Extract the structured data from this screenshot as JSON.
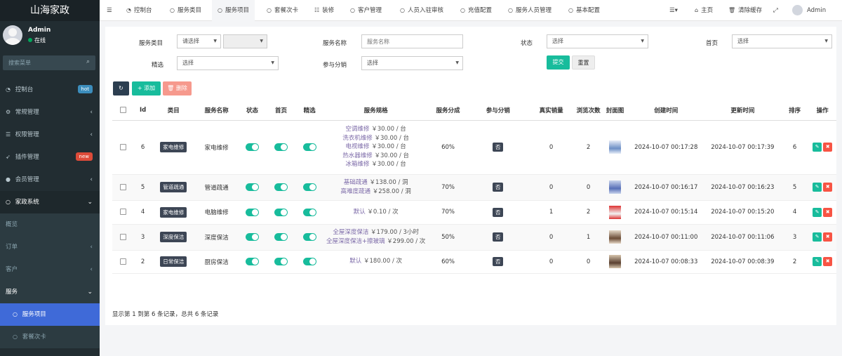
{
  "brand": "山海家政",
  "user": {
    "name": "Admin",
    "status": "在线"
  },
  "search": {
    "placeholder": "搜索菜单"
  },
  "nav": [
    {
      "icon": "dashboard-icon",
      "label": "控制台",
      "badge": "hot",
      "badge_color": "#3c8dbc"
    },
    {
      "icon": "gear-icon",
      "label": "常规管理",
      "chev": "‹"
    },
    {
      "icon": "users-icon",
      "label": "权限管理",
      "chev": "‹"
    },
    {
      "icon": "rocket-icon",
      "label": "插件管理",
      "badge": "new",
      "badge_color": "#dd4b39"
    },
    {
      "icon": "user-icon",
      "label": "会员管理",
      "chev": "‹"
    },
    {
      "icon": "circle-icon",
      "label": "家政系统",
      "chev": "⌄"
    },
    {
      "label": "概览"
    },
    {
      "label": "订单",
      "chev": "‹"
    },
    {
      "label": "客户",
      "chev": "‹"
    },
    {
      "label": "服务",
      "chev": "⌄"
    },
    {
      "icon": "circle-icon",
      "label": "服务项目"
    },
    {
      "icon": "circle-icon",
      "label": "套餐次卡"
    }
  ],
  "topbar": {
    "tabs": [
      {
        "icon": "dashboard-icon",
        "label": "控制台"
      },
      {
        "icon": "circle-icon",
        "label": "服务类目"
      },
      {
        "icon": "circle-icon",
        "label": "服务项目"
      },
      {
        "icon": "circle-icon",
        "label": "套餐次卡"
      },
      {
        "icon": "list-icon",
        "label": "装修"
      },
      {
        "icon": "circle-icon",
        "label": "客户管理"
      },
      {
        "icon": "circle-icon",
        "label": "人员入驻审核"
      },
      {
        "icon": "circle-icon",
        "label": "充值配置"
      },
      {
        "icon": "circle-icon",
        "label": "服务人员管理"
      },
      {
        "icon": "circle-icon",
        "label": "基本配置"
      }
    ],
    "home": "主页",
    "clear_cache": "清除缓存",
    "admin": "Admin"
  },
  "filters": {
    "category_label": "服务类目",
    "category_value": "请选择",
    "name_label": "服务名称",
    "name_placeholder": "服务名称",
    "status_label": "状态",
    "status_value": "选择",
    "home_label": "首页",
    "home_value": "选择",
    "featured_label": "精选",
    "featured_value": "选择",
    "dist_label": "参与分销",
    "dist_value": "选择",
    "submit": "提交",
    "reset": "重置"
  },
  "toolbar": {
    "add": "添加",
    "delete": "删除"
  },
  "table": {
    "headers": [
      "Id",
      "类目",
      "服务名称",
      "状态",
      "首页",
      "精选",
      "服务规格",
      "服务分成",
      "参与分销",
      "真实销量",
      "浏览次数",
      "封面图",
      "创建时间",
      "更新时间",
      "排序",
      "操作"
    ],
    "rows": [
      {
        "id": "6",
        "category": "家电维修",
        "name": "家电维修",
        "specs": [
          [
            "空调维修",
            "￥30.00 / 台"
          ],
          [
            "洗衣机维修",
            "￥30.00 / 台"
          ],
          [
            "电视维修",
            "￥30.00 / 台"
          ],
          [
            "热水器维修",
            "￥30.00 / 台"
          ],
          [
            "冰箱维修",
            "￥30.00 / 台"
          ]
        ],
        "share": "60%",
        "dist": "否",
        "sales": "0",
        "views": "2",
        "created": "2024-10-07 00:17:28",
        "updated": "2024-10-07 00:17:39",
        "sort": "6"
      },
      {
        "id": "5",
        "category": "管道疏通",
        "name": "管道疏通",
        "specs": [
          [
            "基础疏通",
            "￥138.00 / 洞"
          ],
          [
            "高难度疏通",
            "￥258.00 / 洞"
          ]
        ],
        "share": "70%",
        "dist": "否",
        "sales": "0",
        "views": "0",
        "created": "2024-10-07 00:16:17",
        "updated": "2024-10-07 00:16:23",
        "sort": "5"
      },
      {
        "id": "4",
        "category": "家电维修",
        "name": "电脑维修",
        "specs": [
          [
            "默认",
            "￥0.10 / 次"
          ]
        ],
        "share": "70%",
        "dist": "否",
        "sales": "1",
        "views": "2",
        "created": "2024-10-07 00:15:14",
        "updated": "2024-10-07 00:15:20",
        "sort": "4"
      },
      {
        "id": "3",
        "category": "深度保洁",
        "name": "深度保洁",
        "specs": [
          [
            "全屋深度保洁",
            "￥179.00 / 3小时"
          ],
          [
            "全屋深度保洁+擦玻璃",
            "￥299.00 / 次"
          ]
        ],
        "share": "50%",
        "dist": "否",
        "sales": "0",
        "views": "1",
        "created": "2024-10-07 00:11:00",
        "updated": "2024-10-07 00:11:06",
        "sort": "3"
      },
      {
        "id": "2",
        "category": "日常保洁",
        "name": "厨房保洁",
        "specs": [
          [
            "默认",
            "￥180.00 / 次"
          ]
        ],
        "share": "60%",
        "dist": "否",
        "sales": "0",
        "views": "0",
        "created": "2024-10-07 00:08:33",
        "updated": "2024-10-07 00:08:39",
        "sort": "2"
      }
    ]
  },
  "footer": "显示第 1 到第 6 条记录，总共 6 条记录",
  "colors": {
    "sidebar": "#222d32",
    "accent": "#18bc9c",
    "danger": "#f75444",
    "active": "#3f6ad8"
  }
}
